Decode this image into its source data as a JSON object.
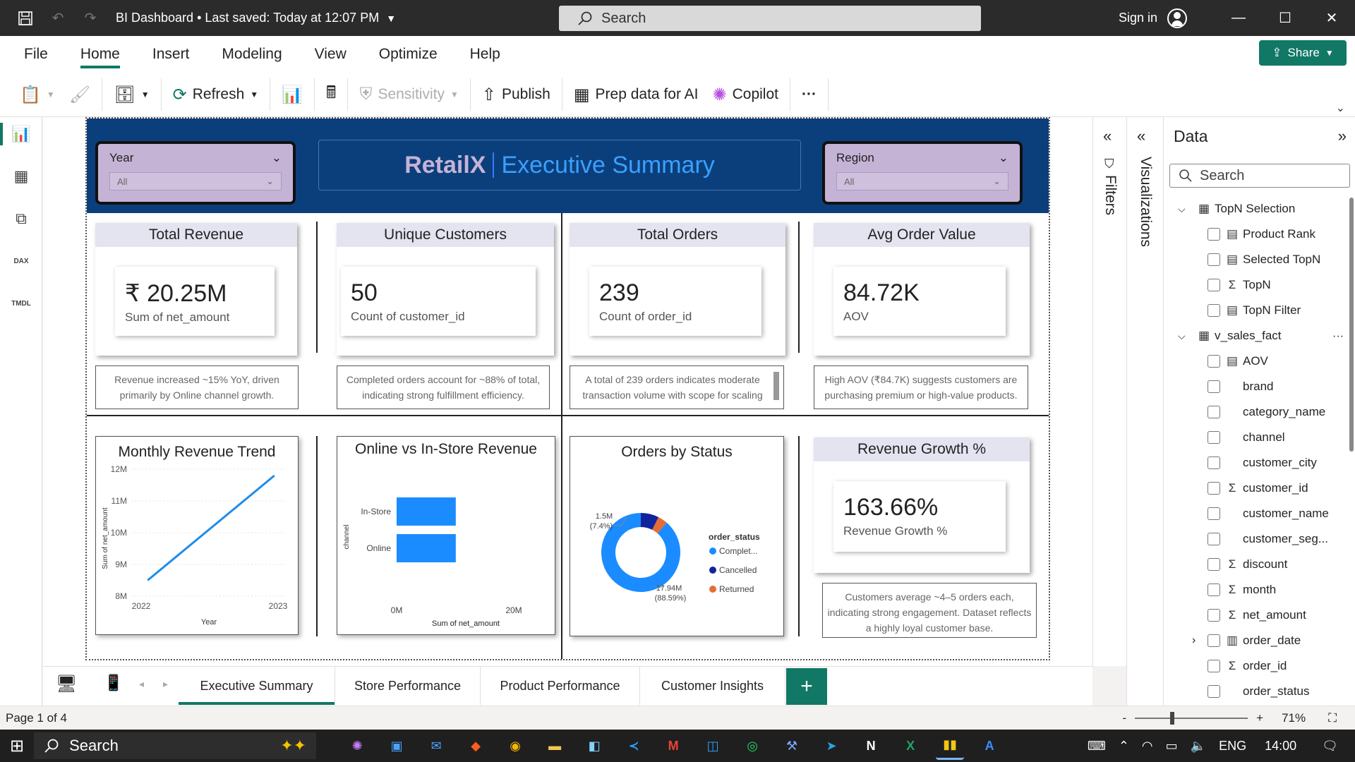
{
  "titlebar": {
    "title": "BI Dashboard • Last saved: Today at 12:07 PM",
    "search_placeholder": "Search",
    "signin": "Sign in"
  },
  "menu": {
    "items": [
      "File",
      "Home",
      "Insert",
      "Modeling",
      "View",
      "Optimize",
      "Help"
    ],
    "active": "Home",
    "share": "Share"
  },
  "ribbon": {
    "refresh": "Refresh",
    "sensitivity": "Sensitivity",
    "publish": "Publish",
    "prep": "Prep data for AI",
    "copilot": "Copilot",
    "more": "···"
  },
  "report": {
    "brand": "RetailX",
    "subtitle": "Executive Summary",
    "slicers": [
      {
        "label": "Year",
        "value": "All"
      },
      {
        "label": "Region",
        "value": "All"
      }
    ],
    "kpis": [
      {
        "title": "Total Revenue",
        "value": "₹ 20.25M",
        "sub": "Sum of net_amount",
        "note": "Revenue increased ~15% YoY, driven primarily by Online channel growth."
      },
      {
        "title": "Unique Customers",
        "value": "50",
        "sub": "Count of customer_id",
        "note": "Completed orders account for ~88% of total, indicating strong fulfillment efficiency."
      },
      {
        "title": "Total Orders",
        "value": "239",
        "sub": "Count of order_id",
        "note": "A total of 239 orders indicates moderate transaction volume with scope for scaling"
      },
      {
        "title": "Avg Order Value",
        "value": "84.72K",
        "sub": "AOV",
        "note": "High AOV (₹84.7K) suggests customers are purchasing premium or high-value products."
      }
    ],
    "growth": {
      "title": "Revenue Growth %",
      "value": "163.66%",
      "sub": "Revenue Growth %",
      "note": "Customers average ~4–5 orders each, indicating strong engagement. Dataset reflects a highly loyal customer base."
    }
  },
  "chart_data": [
    {
      "type": "line",
      "title": "Monthly Revenue Trend",
      "xlabel": "Year",
      "ylabel": "Sum of net_amount",
      "x_ticks": [
        "2022",
        "2023"
      ],
      "y_ticks": [
        "12M",
        "11M",
        "10M",
        "9M",
        "8M"
      ],
      "ylim": [
        8,
        12
      ],
      "series": [
        {
          "x": [
            2022,
            2023
          ],
          "values": [
            8.5,
            11.8
          ]
        }
      ],
      "color": "#1f8de8"
    },
    {
      "type": "bar",
      "orientation": "horizontal",
      "title": "Online vs In-Store Revenue",
      "xlabel": "Sum of net_amount",
      "ylabel": "channel",
      "categories": [
        "In-Store",
        "Online"
      ],
      "values": [
        10.1,
        10.1
      ],
      "x_ticks": [
        "0M",
        "20M"
      ],
      "xlim": [
        0,
        20
      ],
      "color": "#1a8cff"
    },
    {
      "type": "pie",
      "title": "Orders by Status",
      "legend_title": "order_status",
      "categories": [
        "Complet...",
        "Cancelled",
        "Returned"
      ],
      "values": [
        17.94,
        1.5,
        0.81
      ],
      "colors": [
        "#1a8cff",
        "#12239e",
        "#e66c37"
      ],
      "labels": [
        {
          "value": "17.94M",
          "pct": "(88.59%)"
        },
        {
          "value": "1.5M",
          "pct": "(7.4%)"
        }
      ]
    }
  ],
  "panes": {
    "filters": "Filters",
    "visualizations": "Visualizations",
    "data_title": "Data",
    "data_search": "Search",
    "fields": [
      {
        "name": "TopN Selection",
        "level": 0,
        "icon": "table",
        "expand": "⌵"
      },
      {
        "name": "Product Rank",
        "level": 1,
        "icon": "calc"
      },
      {
        "name": "Selected TopN",
        "level": 1,
        "icon": "calc"
      },
      {
        "name": "TopN",
        "level": 1,
        "icon": "sigma"
      },
      {
        "name": "TopN Filter",
        "level": 1,
        "icon": "calc"
      },
      {
        "name": "v_sales_fact",
        "level": 0,
        "icon": "table",
        "expand": "⌵"
      },
      {
        "name": "AOV",
        "level": 1,
        "icon": "calc"
      },
      {
        "name": "brand",
        "level": 1,
        "icon": ""
      },
      {
        "name": "category_name",
        "level": 1,
        "icon": ""
      },
      {
        "name": "channel",
        "level": 1,
        "icon": ""
      },
      {
        "name": "customer_city",
        "level": 1,
        "icon": ""
      },
      {
        "name": "customer_id",
        "level": 1,
        "icon": "sigma"
      },
      {
        "name": "customer_name",
        "level": 1,
        "icon": ""
      },
      {
        "name": "customer_seg...",
        "level": 1,
        "icon": ""
      },
      {
        "name": "discount",
        "level": 1,
        "icon": "sigma"
      },
      {
        "name": "month",
        "level": 1,
        "icon": "sigma"
      },
      {
        "name": "net_amount",
        "level": 1,
        "icon": "sigma"
      },
      {
        "name": "order_date",
        "level": 1,
        "icon": "calendar",
        "expand": "›"
      },
      {
        "name": "order_id",
        "level": 1,
        "icon": "sigma"
      },
      {
        "name": "order_status",
        "level": 1,
        "icon": ""
      }
    ]
  },
  "pages": {
    "tabs": [
      "Executive Summary",
      "Store Performance",
      "Product Performance",
      "Customer Insights"
    ],
    "active": "Executive Summary",
    "add": "+"
  },
  "status": {
    "page": "Page 1 of 4",
    "zoom": "71%"
  },
  "taskbar": {
    "search": "Search",
    "lang": "ENG",
    "time": "14:00"
  }
}
